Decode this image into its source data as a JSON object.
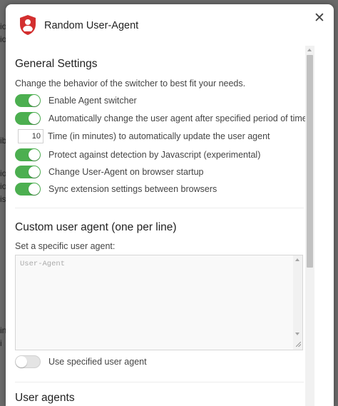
{
  "background_fragments": [
    "io",
    "io",
    "ib",
    "io",
    "io",
    "is",
    "in",
    "i"
  ],
  "dialog": {
    "title": "Random User-Agent",
    "shield_color": "#d32f2f",
    "accent_color": "#4caf50"
  },
  "general": {
    "heading": "General Settings",
    "description": "Change the behavior of the switcher to best fit your needs.",
    "settings": [
      {
        "type": "toggle",
        "state": "on",
        "label": "Enable Agent switcher"
      },
      {
        "type": "toggle",
        "state": "on",
        "label": "Automatically change the user agent after specified period of time"
      },
      {
        "type": "number",
        "value": "10",
        "label": "Time (in minutes) to automatically update the user agent"
      },
      {
        "type": "toggle",
        "state": "on",
        "label": "Protect against detection by Javascript (experimental)"
      },
      {
        "type": "toggle",
        "state": "on",
        "label": "Change User-Agent on browser startup"
      },
      {
        "type": "toggle",
        "state": "on",
        "label": "Sync extension settings between browsers"
      }
    ]
  },
  "custom": {
    "heading": "Custom user agent (one per line)",
    "subheading": "Set a specific user agent:",
    "textarea_placeholder": "User-Agent",
    "textarea_value": "",
    "use_specified_label": "Use specified user agent",
    "use_specified_state": "off"
  },
  "user_agents": {
    "heading": "User agents"
  }
}
